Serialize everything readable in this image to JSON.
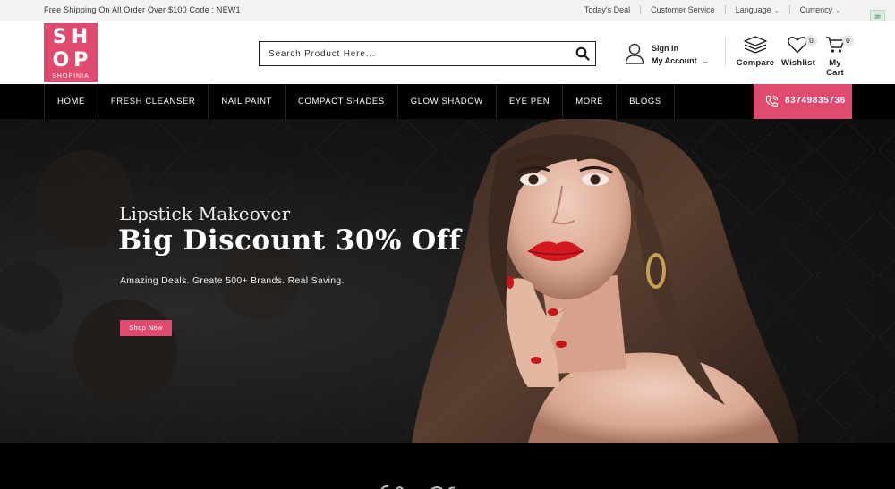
{
  "topbar": {
    "promo": "Free Shipping On All Order Over $100 Code : NEW1",
    "links": [
      "Today's Deal",
      "Customer Service",
      "Language",
      "Currency"
    ]
  },
  "header": {
    "logo": {
      "line1": "SH",
      "line2": "OP",
      "line3": "SHOPINIA"
    },
    "search": {
      "placeholder": "Search Product Here..."
    },
    "account": {
      "signin": "Sign In",
      "my_account": "My Account"
    },
    "compare_label": "Compare",
    "wishlist_label": "Wishlist",
    "wishlist_count": "0",
    "cart_label": "My Cart",
    "cart_count": "0"
  },
  "nav": {
    "items": [
      "HOME",
      "FRESH CLEANSER",
      "NAIL PAINT",
      "COMPACT SHADES",
      "GLOW SHADOW",
      "EYE PEN",
      "MORE",
      "BLOGS"
    ],
    "phone": "83749835736"
  },
  "hero": {
    "subtitle": "Lipstick Makeover",
    "title": "Big Discount 30% Off",
    "description": "Amazing Deals. Greate 500+ Brands. Real Saving.",
    "button": "Shop Now"
  },
  "colors": {
    "accent": "#e04a6f",
    "nav_bg": "#000000",
    "topbar_bg": "#f2f2f2"
  },
  "icons": [
    "search-icon",
    "user-icon",
    "compare-icon",
    "heart-icon",
    "cart-icon",
    "phone-icon",
    "chevron-down-icon"
  ]
}
